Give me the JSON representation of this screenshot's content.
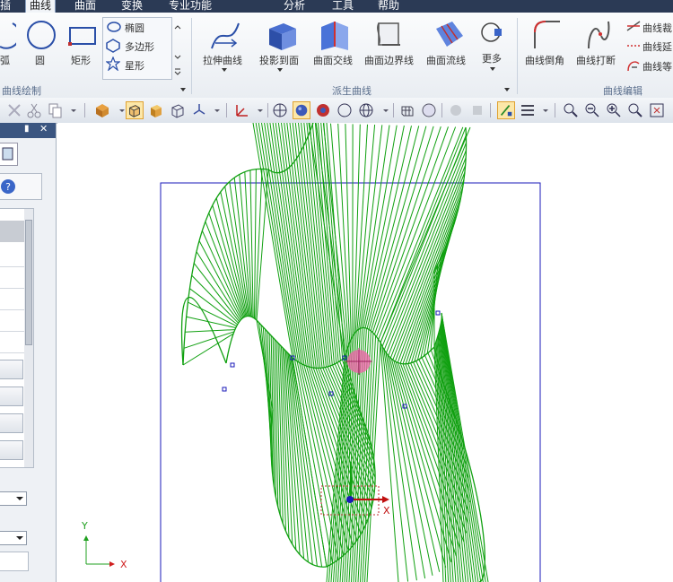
{
  "menu": {
    "items": [
      {
        "label": "插",
        "active": false
      },
      {
        "label": "曲线",
        "active": true
      },
      {
        "label": "曲面",
        "active": false
      },
      {
        "label": "变换",
        "active": false
      },
      {
        "label": "专业功能",
        "active": false
      },
      {
        "label": "分析",
        "active": false
      },
      {
        "label": "工具",
        "active": false
      },
      {
        "label": "帮助",
        "active": false
      }
    ]
  },
  "ribbon": {
    "curve_draw": {
      "group_label": "曲线绘制",
      "arc_label": "弧",
      "circle_label": "圆",
      "rect_label": "矩形",
      "ellipse_label": "椭圆",
      "polygon_label": "多边形",
      "star_label": "星形"
    },
    "derived": {
      "group_label": "派生曲线",
      "extend_label": "拉伸曲线",
      "project_label": "投影到面",
      "intersect_label": "曲面交线",
      "boundary_label": "曲面边界线",
      "flowline_label": "曲面流线",
      "more_label": "更多"
    },
    "edit": {
      "group_label": "曲线编辑",
      "fillet_label": "曲线倒角",
      "break_label": "曲线打断",
      "trim_label": "曲线裁",
      "extend_label": "曲线延",
      "equal_label": "曲线等"
    }
  },
  "panel": {
    "pin_label": "▮",
    "close_label": "✕"
  },
  "canvas": {
    "axis_x_label": "X",
    "axis_y_label": "Y",
    "gizmo_x_label": "X"
  },
  "colors": {
    "curve": "#10a010",
    "frame": "#1a1ab8",
    "menubar": "#2b3a55"
  }
}
